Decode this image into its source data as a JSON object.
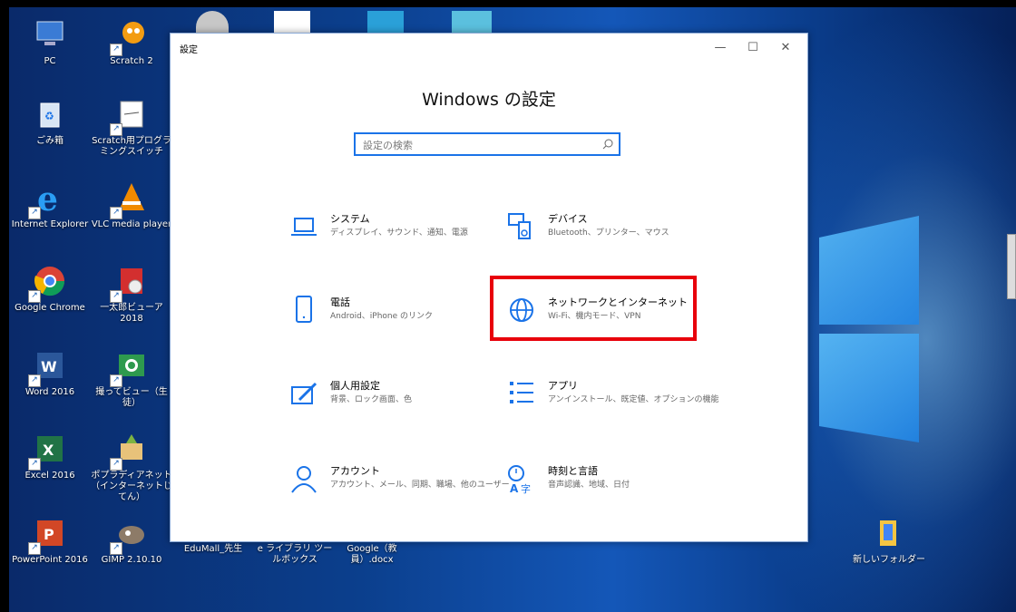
{
  "window": {
    "title": "設定",
    "heading": "Windows の設定",
    "controls": {
      "minimize": "—",
      "maximize": "☐",
      "close": "✕"
    }
  },
  "search": {
    "placeholder": "設定の検索"
  },
  "settings": [
    {
      "title": "システム",
      "desc": "ディスプレイ、サウンド、通知、電源",
      "icon": "laptop-icon"
    },
    {
      "title": "デバイス",
      "desc": "Bluetooth、プリンター、マウス",
      "icon": "devices-icon"
    },
    {
      "title": "電話",
      "desc": "Android、iPhone のリンク",
      "icon": "phone-icon"
    },
    {
      "title": "ネットワークとインターネット",
      "desc": "Wi-Fi、機内モード、VPN",
      "icon": "globe-icon"
    },
    {
      "title": "個人用設定",
      "desc": "背景、ロック画面、色",
      "icon": "personalization-icon"
    },
    {
      "title": "アプリ",
      "desc": "アンインストール、既定値、オプションの機能",
      "icon": "apps-icon"
    },
    {
      "title": "アカウント",
      "desc": "アカウント、メール、同期、職場、他のユーザー",
      "icon": "account-icon"
    },
    {
      "title": "時刻と言語",
      "desc": "音声認識、地域、日付",
      "icon": "time-language-icon"
    }
  ],
  "desktop_icons": [
    {
      "label": "PC",
      "icon": "pc-icon"
    },
    {
      "label": "Scratch 2",
      "icon": "scratch-icon"
    },
    {
      "label": "ごみ箱",
      "icon": "recycle-bin-icon"
    },
    {
      "label": "Scratch用プログラミングスイッチ",
      "icon": "switch-icon"
    },
    {
      "label": "Internet Explorer",
      "icon": "ie-icon"
    },
    {
      "label": "VLC media player",
      "icon": "vlc-icon"
    },
    {
      "label": "Google Chrome",
      "icon": "chrome-icon"
    },
    {
      "label": "一太郎ビューア2018",
      "icon": "viewer-icon"
    },
    {
      "label": "Word 2016",
      "icon": "word-icon"
    },
    {
      "label": "撮ってビュー（生徒）",
      "icon": "camera-icon"
    },
    {
      "label": "Excel 2016",
      "icon": "excel-icon"
    },
    {
      "label": "ポプラディアネット（インターネットじてん）",
      "icon": "poplar-icon"
    },
    {
      "label": "PowerPoint 2016",
      "icon": "powerpoint-icon"
    },
    {
      "label": "GIMP 2.10.10",
      "icon": "gimp-icon"
    },
    {
      "label": "EduMall_先生",
      "icon": "edumall-icon"
    },
    {
      "label": "e ライブラリ ツールボックス",
      "icon": "elibrary-icon"
    },
    {
      "label": "Google（教員）.docx",
      "icon": "docx-icon"
    },
    {
      "label": "新しいフォルダー",
      "icon": "folder-icon"
    }
  ],
  "colors": {
    "accent": "#1a73e8",
    "highlight": "#e8000b"
  }
}
